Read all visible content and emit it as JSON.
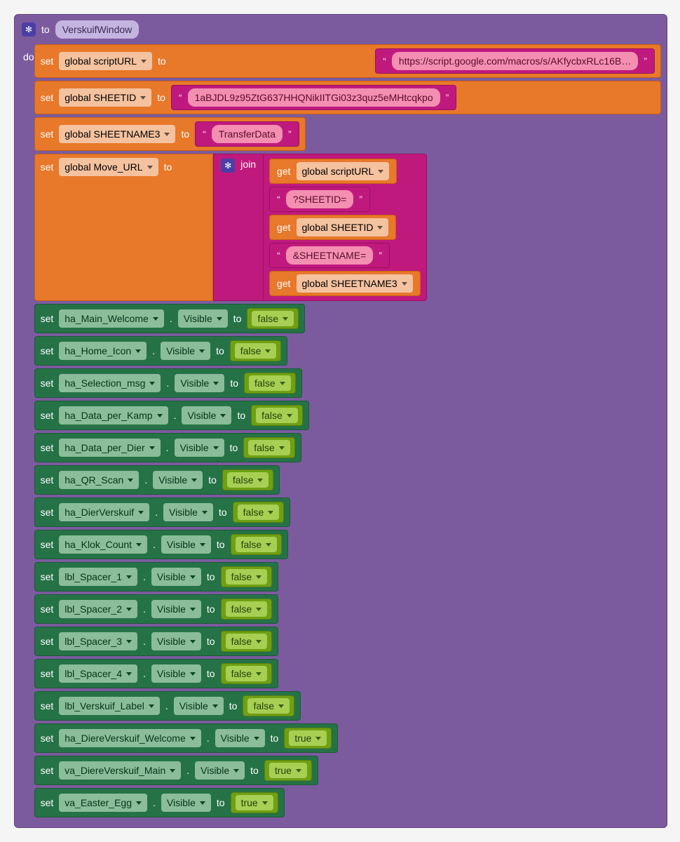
{
  "proc": {
    "to": "to",
    "name": "VerskuifWindow",
    "do": "do"
  },
  "kw": {
    "set": "set",
    "to": "to",
    "get": "get",
    "join": "join"
  },
  "globals": {
    "scriptURL": {
      "var": "global scriptURL",
      "value": "https://script.google.com/macros/s/AKfycbxRLc16B…"
    },
    "SHEETID": {
      "var": "global SHEETID",
      "value": "1aBJDL9z95ZtG637HHQNikIITGi03z3quz5eMHtcqkpo"
    },
    "SHEETNAME3": {
      "var": "global SHEETNAME3",
      "value": "TransferData"
    },
    "Move_URL": {
      "var": "global Move_URL"
    }
  },
  "join": {
    "parts": [
      {
        "type": "get",
        "var": "global scriptURL"
      },
      {
        "type": "str",
        "value": "?SHEETID="
      },
      {
        "type": "get",
        "var": "global SHEETID"
      },
      {
        "type": "str",
        "value": "&SHEETNAME="
      },
      {
        "type": "get",
        "var": "global SHEETNAME3"
      }
    ]
  },
  "greens": [
    {
      "comp": "ha_Main_Welcome",
      "prop": "Visible",
      "val": "false"
    },
    {
      "comp": "ha_Home_Icon",
      "prop": "Visible",
      "val": "false"
    },
    {
      "comp": "ha_Selection_msg",
      "prop": "Visible",
      "val": "false"
    },
    {
      "comp": "ha_Data_per_Kamp",
      "prop": "Visible",
      "val": "false"
    },
    {
      "comp": "ha_Data_per_Dier",
      "prop": "Visible",
      "val": "false"
    },
    {
      "comp": "ha_QR_Scan",
      "prop": "Visible",
      "val": "false"
    },
    {
      "comp": "ha_DierVerskuif",
      "prop": "Visible",
      "val": "false"
    },
    {
      "comp": "ha_Klok_Count",
      "prop": "Visible",
      "val": "false"
    },
    {
      "comp": "lbl_Spacer_1",
      "prop": "Visible",
      "val": "false"
    },
    {
      "comp": "lbl_Spacer_2",
      "prop": "Visible",
      "val": "false"
    },
    {
      "comp": "lbl_Spacer_3",
      "prop": "Visible",
      "val": "false"
    },
    {
      "comp": "lbl_Spacer_4",
      "prop": "Visible",
      "val": "false"
    },
    {
      "comp": "lbl_Verskuif_Label",
      "prop": "Visible",
      "val": "false"
    },
    {
      "comp": "ha_DiereVerskuif_Welcome",
      "prop": "Visible",
      "val": "true"
    },
    {
      "comp": "va_DiereVerskuif_Main",
      "prop": "Visible",
      "val": "true"
    },
    {
      "comp": "va_Easter_Egg",
      "prop": "Visible",
      "val": "true"
    }
  ]
}
